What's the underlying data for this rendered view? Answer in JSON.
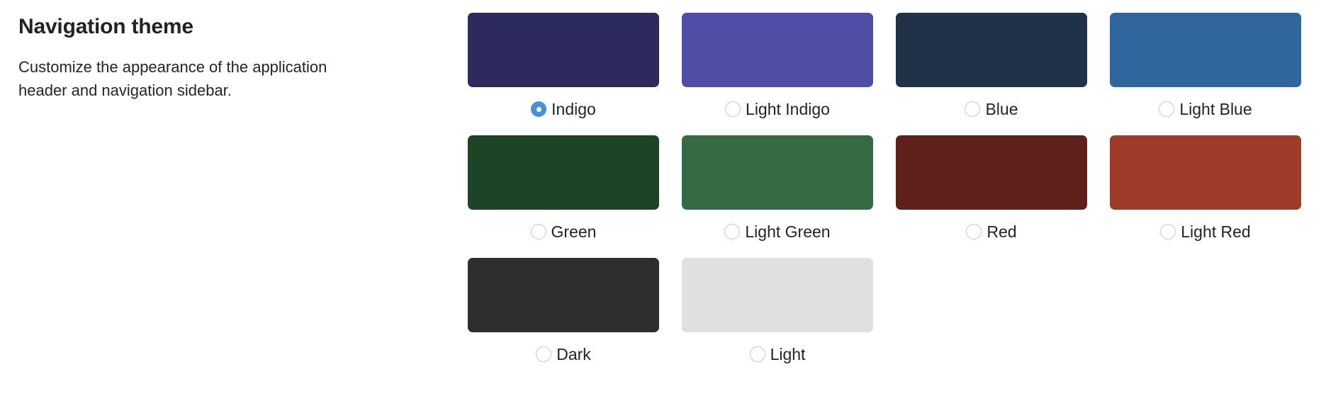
{
  "section": {
    "title": "Navigation theme",
    "description": "Customize the appearance of the application header and navigation sidebar."
  },
  "accent_color": "#4a90d9",
  "radio_border_color": "#c4c8cc",
  "selected_theme": "Indigo",
  "themes": [
    {
      "label": "Indigo",
      "color": "#2d2b5e",
      "selected": true
    },
    {
      "label": "Light Indigo",
      "color": "#4f4ea5",
      "selected": false
    },
    {
      "label": "Blue",
      "color": "#1f3248",
      "selected": false
    },
    {
      "label": "Light Blue",
      "color": "#31659e",
      "selected": false
    },
    {
      "label": "Green",
      "color": "#1e4427",
      "selected": false
    },
    {
      "label": "Light Green",
      "color": "#356b42",
      "selected": false
    },
    {
      "label": "Red",
      "color": "#5e201a",
      "selected": false
    },
    {
      "label": "Light Red",
      "color": "#9e3b28",
      "selected": false
    },
    {
      "label": "Dark",
      "color": "#2e2e2e",
      "selected": false
    },
    {
      "label": "Light",
      "color": "#e0e0e0",
      "selected": false
    }
  ]
}
